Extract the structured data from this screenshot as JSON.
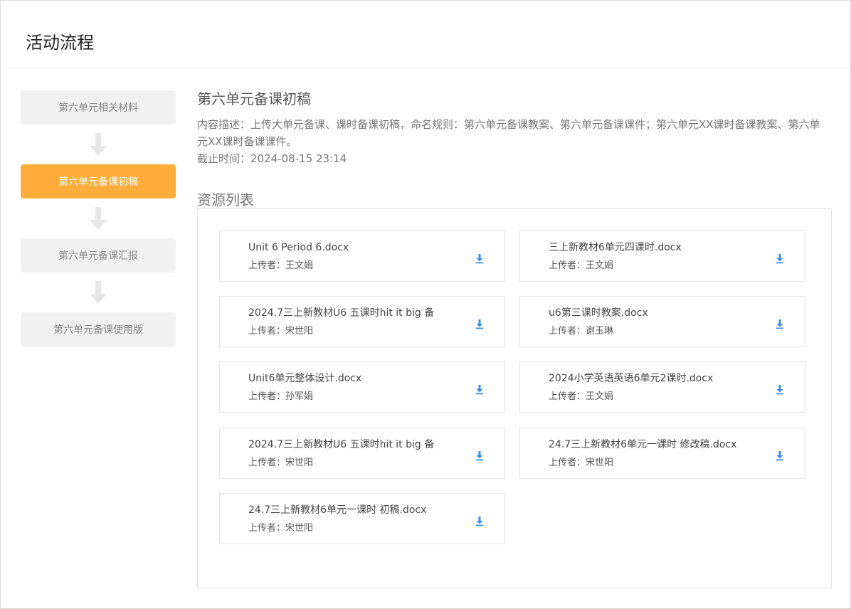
{
  "page": {
    "title": "活动流程"
  },
  "flow": {
    "steps": [
      {
        "label": "第六单元相关材料",
        "active": false
      },
      {
        "label": "第六单元备课初稿",
        "active": true
      },
      {
        "label": "第六单元备课汇报",
        "active": false
      },
      {
        "label": "第六单元备课使用版",
        "active": false
      }
    ]
  },
  "stage": {
    "title": "第六单元备课初稿",
    "description": "内容描述：上传大单元备课、课时备课初稿，命名规则：第六单元备课教案、第六单元备课课件；第六单元XX课时备课教案、第六单元XX课时备课课件。",
    "deadline_label": "截止时间：",
    "deadline_value": "2024-08-15 23:14"
  },
  "resources": {
    "title": "资源列表",
    "uploader_label": "上传者：",
    "items": [
      {
        "name": "Unit 6 Period 6.docx",
        "uploader": "王文娟"
      },
      {
        "name": "三上新教材6单元四课时.docx",
        "uploader": "王文娟"
      },
      {
        "name": "2024.7三上新教材U6 五课时hit it big 备",
        "uploader": "宋世阳"
      },
      {
        "name": "u6第三课时教案.docx",
        "uploader": "谢玉琳"
      },
      {
        "name": "Unit6单元整体设计.docx",
        "uploader": "孙军娟"
      },
      {
        "name": "2024小学英语英语6单元2课时.docx",
        "uploader": "王文娟"
      },
      {
        "name": "2024.7三上新教材U6 五课时hit it big 备",
        "uploader": "宋世阳"
      },
      {
        "name": "24.7三上新教材6单元一课时 修改稿.docx",
        "uploader": "宋世阳"
      },
      {
        "name": "24.7三上新教材6单元一课时 初稿.docx",
        "uploader": "宋世阳"
      }
    ]
  },
  "icons": {
    "download": "download-icon",
    "arrow": "arrow-down-icon"
  },
  "colors": {
    "active_step": "#ffad3a",
    "download": "#3a8ee6",
    "arrow": "#e6e6e6"
  }
}
